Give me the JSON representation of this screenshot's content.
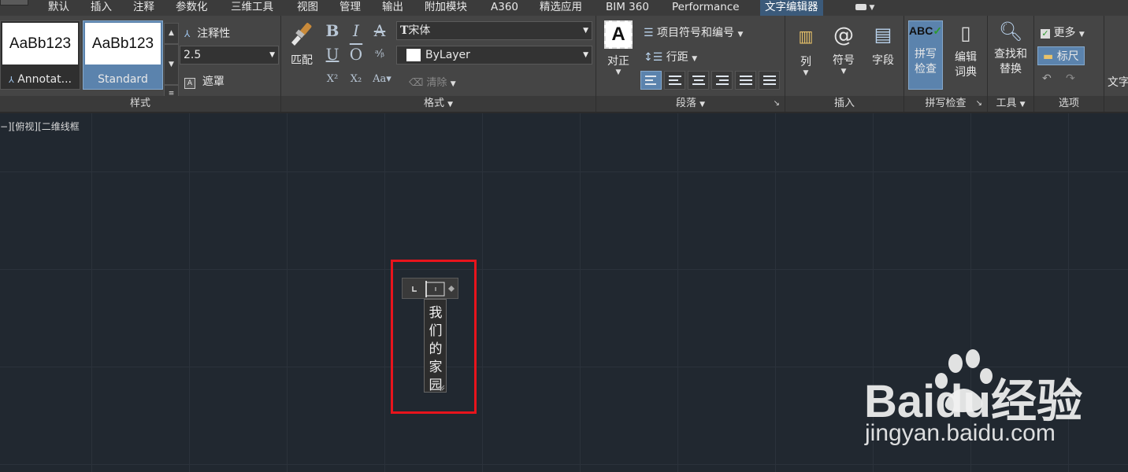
{
  "tabs": [
    {
      "label": "默认",
      "active": false
    },
    {
      "label": "插入",
      "active": false
    },
    {
      "label": "注释",
      "active": false
    },
    {
      "label": "参数化",
      "active": false
    },
    {
      "label": "三维工具",
      "active": false
    },
    {
      "label": "视图",
      "active": false
    },
    {
      "label": "管理",
      "active": false
    },
    {
      "label": "输出",
      "active": false
    },
    {
      "label": "附加模块",
      "active": false
    },
    {
      "label": "A360",
      "active": false
    },
    {
      "label": "精选应用",
      "active": false
    },
    {
      "label": "BIM 360",
      "active": false
    },
    {
      "label": "Performance",
      "active": false
    },
    {
      "label": "文字编辑器",
      "active": true
    }
  ],
  "style_panel": {
    "title": "样式",
    "swatches": [
      {
        "preview": "AaBb123",
        "name": "Annotat...",
        "active": false
      },
      {
        "preview": "AaBb123",
        "name": "Standard",
        "active": true
      }
    ],
    "annotative_label": "注释性",
    "text_height": "2.5",
    "mask_label": "遮罩"
  },
  "format_panel": {
    "title": "格式",
    "match_label": "匹配",
    "font": "宋体",
    "color": "ByLayer",
    "clear_label": "清除"
  },
  "paragraph_panel": {
    "title": "段落",
    "justify_label": "对正",
    "bullets_label": "项目符号和编号",
    "line_spacing_label": "行距"
  },
  "insert_panel": {
    "title": "插入",
    "columns_label": "列",
    "symbol_label": "符号",
    "field_label": "字段"
  },
  "spell_panel": {
    "title": "拼写检查",
    "spellcheck_label": [
      "拼写",
      "检查"
    ],
    "dictionary_label": [
      "编辑",
      "词典"
    ]
  },
  "tools_panel": {
    "title": "工具",
    "find_replace_label": [
      "查找和",
      "替换"
    ]
  },
  "options_panel": {
    "title": "选项",
    "more_label": "更多",
    "ruler_label": "标尺"
  },
  "close_panel": {
    "label": "文字"
  },
  "canvas": {
    "viewport_label": "−][俯视][二维线框",
    "editor_text": [
      "我",
      "们",
      "的",
      "家",
      "园"
    ]
  },
  "watermark": {
    "logo_text": "Baidu经验",
    "url_text": "jingyan.baidu.com"
  },
  "colors": {
    "accent": "#5b83ad",
    "highlight": "#e8141c"
  }
}
